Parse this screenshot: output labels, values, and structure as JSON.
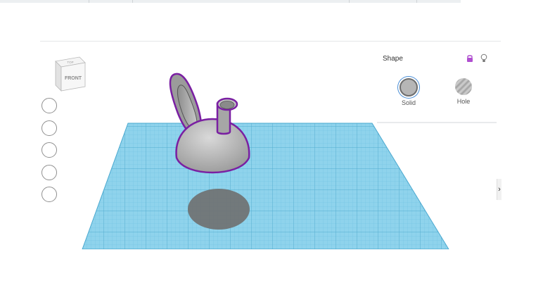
{
  "viewcube": {
    "top_face_label": "TOP",
    "front_face_label": "FRONT"
  },
  "nav_buttons": [
    "home-view",
    "fit-view",
    "zoom-in",
    "zoom-out",
    "ortho-view"
  ],
  "shape_panel": {
    "title": "Shape",
    "solid_label": "Solid",
    "hole_label": "Hole",
    "selected_option": "Solid"
  },
  "edge_handle_glyph": "›",
  "colors": {
    "workplane": "#8fd3ec",
    "grid_line": "#5fb3d4",
    "selection_outline": "#7a1fa2",
    "shape": "#bdbdbd",
    "shadow": "#6f6f6f",
    "lock": "#b04fd0"
  }
}
